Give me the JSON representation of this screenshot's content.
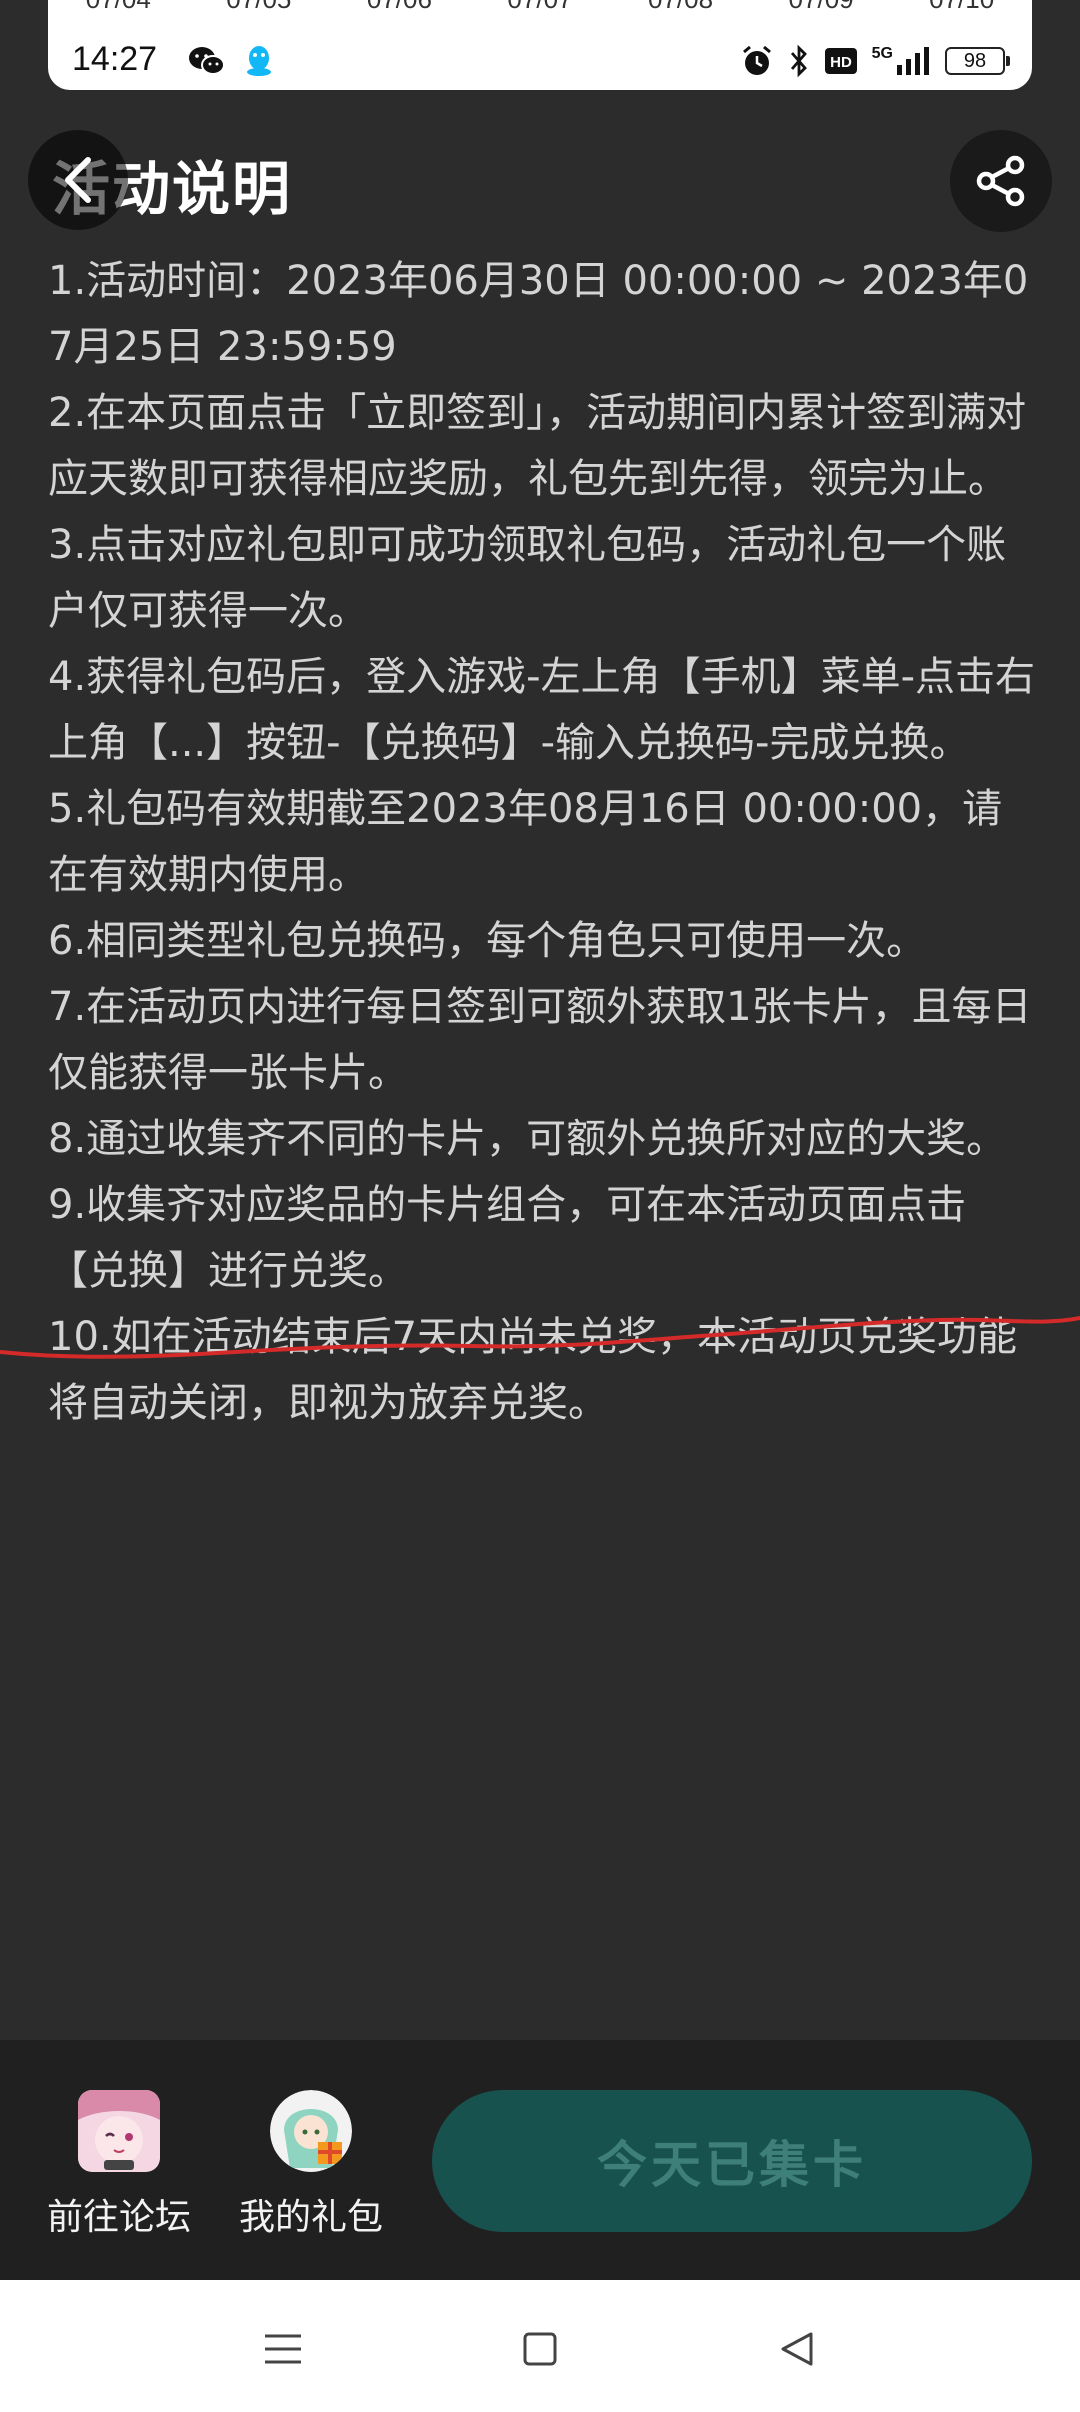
{
  "status_bar": {
    "dates": [
      "07/04",
      "07/05",
      "07/06",
      "07/07",
      "07/08",
      "07/09",
      "07/10"
    ],
    "time": "14:27",
    "network": "5G",
    "battery": "98"
  },
  "header": {
    "title": "活动说明"
  },
  "rules": [
    "1.活动时间：2023年06月30日 00:00:00 ~ 2023年07月25日 23:59:59",
    "2.在本页面点击「立即签到」，活动期间内累计签到满对应天数即可获得相应奖励，礼包先到先得，领完为止。",
    "3.点击对应礼包即可成功领取礼包码，活动礼包一个账户仅可获得一次。",
    "4.获得礼包码后，登入游戏-左上角【手机】菜单-点击右上角【...】按钮-【兑换码】-输入兑换码-完成兑换。",
    "5.礼包码有效期截至2023年08月16日 00:00:00，请在有效期内使用。",
    "6.相同类型礼包兑换码，每个角色只可使用一次。",
    "7.在活动页内进行每日签到可额外获取1张卡片，且每日仅能获得一张卡片。",
    "8.通过收集齐不同的卡片，可额外兑换所对应的大奖。",
    "9.收集齐对应奖品的卡片组合，可在本活动页面点击【兑换】进行兑奖。",
    "10.如在活动结束后7天内尚未兑奖，本活动页兑奖功能将自动关闭，即视为放弃兑奖。"
  ],
  "bottom_bar": {
    "forum_label": "前往论坛",
    "gifts_label": "我的礼包",
    "collect_button": "今天已集卡"
  },
  "colors": {
    "background": "#2c2c2c",
    "bottom_bar": "#202020",
    "button_bg": "#18524e",
    "button_text": "#3f7f79",
    "annotation_line": "#d42a2a"
  }
}
